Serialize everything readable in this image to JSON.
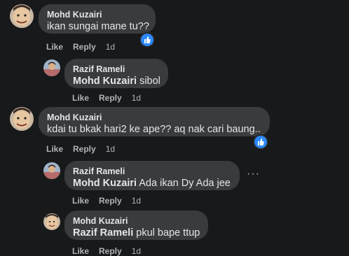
{
  "comments": [
    {
      "author": "Mohd Kuzairi",
      "mention": "",
      "text": "ikan sungai mane tu??",
      "actions": {
        "like": "Like",
        "reply": "Reply",
        "time": "1d"
      }
    },
    {
      "author": "Razif Rameli",
      "mention": "Mohd Kuzairi",
      "text": "sibol",
      "actions": {
        "like": "Like",
        "reply": "Reply",
        "time": "1d"
      }
    },
    {
      "author": "Mohd Kuzairi",
      "mention": "",
      "text": "kdai tu bkak hari2 ke ape?? aq nak cari baung..",
      "actions": {
        "like": "Like",
        "reply": "Reply",
        "time": "1d"
      }
    },
    {
      "author": "Razif Rameli",
      "mention": "Mohd Kuzairi",
      "text": "Ada ikan Dy Ada jee",
      "actions": {
        "like": "Like",
        "reply": "Reply",
        "time": "1d"
      }
    },
    {
      "author": "Mohd Kuzairi",
      "mention": "Razif Rameli",
      "text": "pkul bape ttup",
      "actions": {
        "like": "Like",
        "reply": "Reply",
        "time": "1d"
      }
    }
  ],
  "icons": {
    "like_reaction": "thumbs-up-icon",
    "more_options": "more-options-icon"
  },
  "colors": {
    "background": "#18191a",
    "bubble": "#3a3b3c",
    "like_badge": "#2d88ff",
    "secondary_text": "#b0b3b8"
  }
}
